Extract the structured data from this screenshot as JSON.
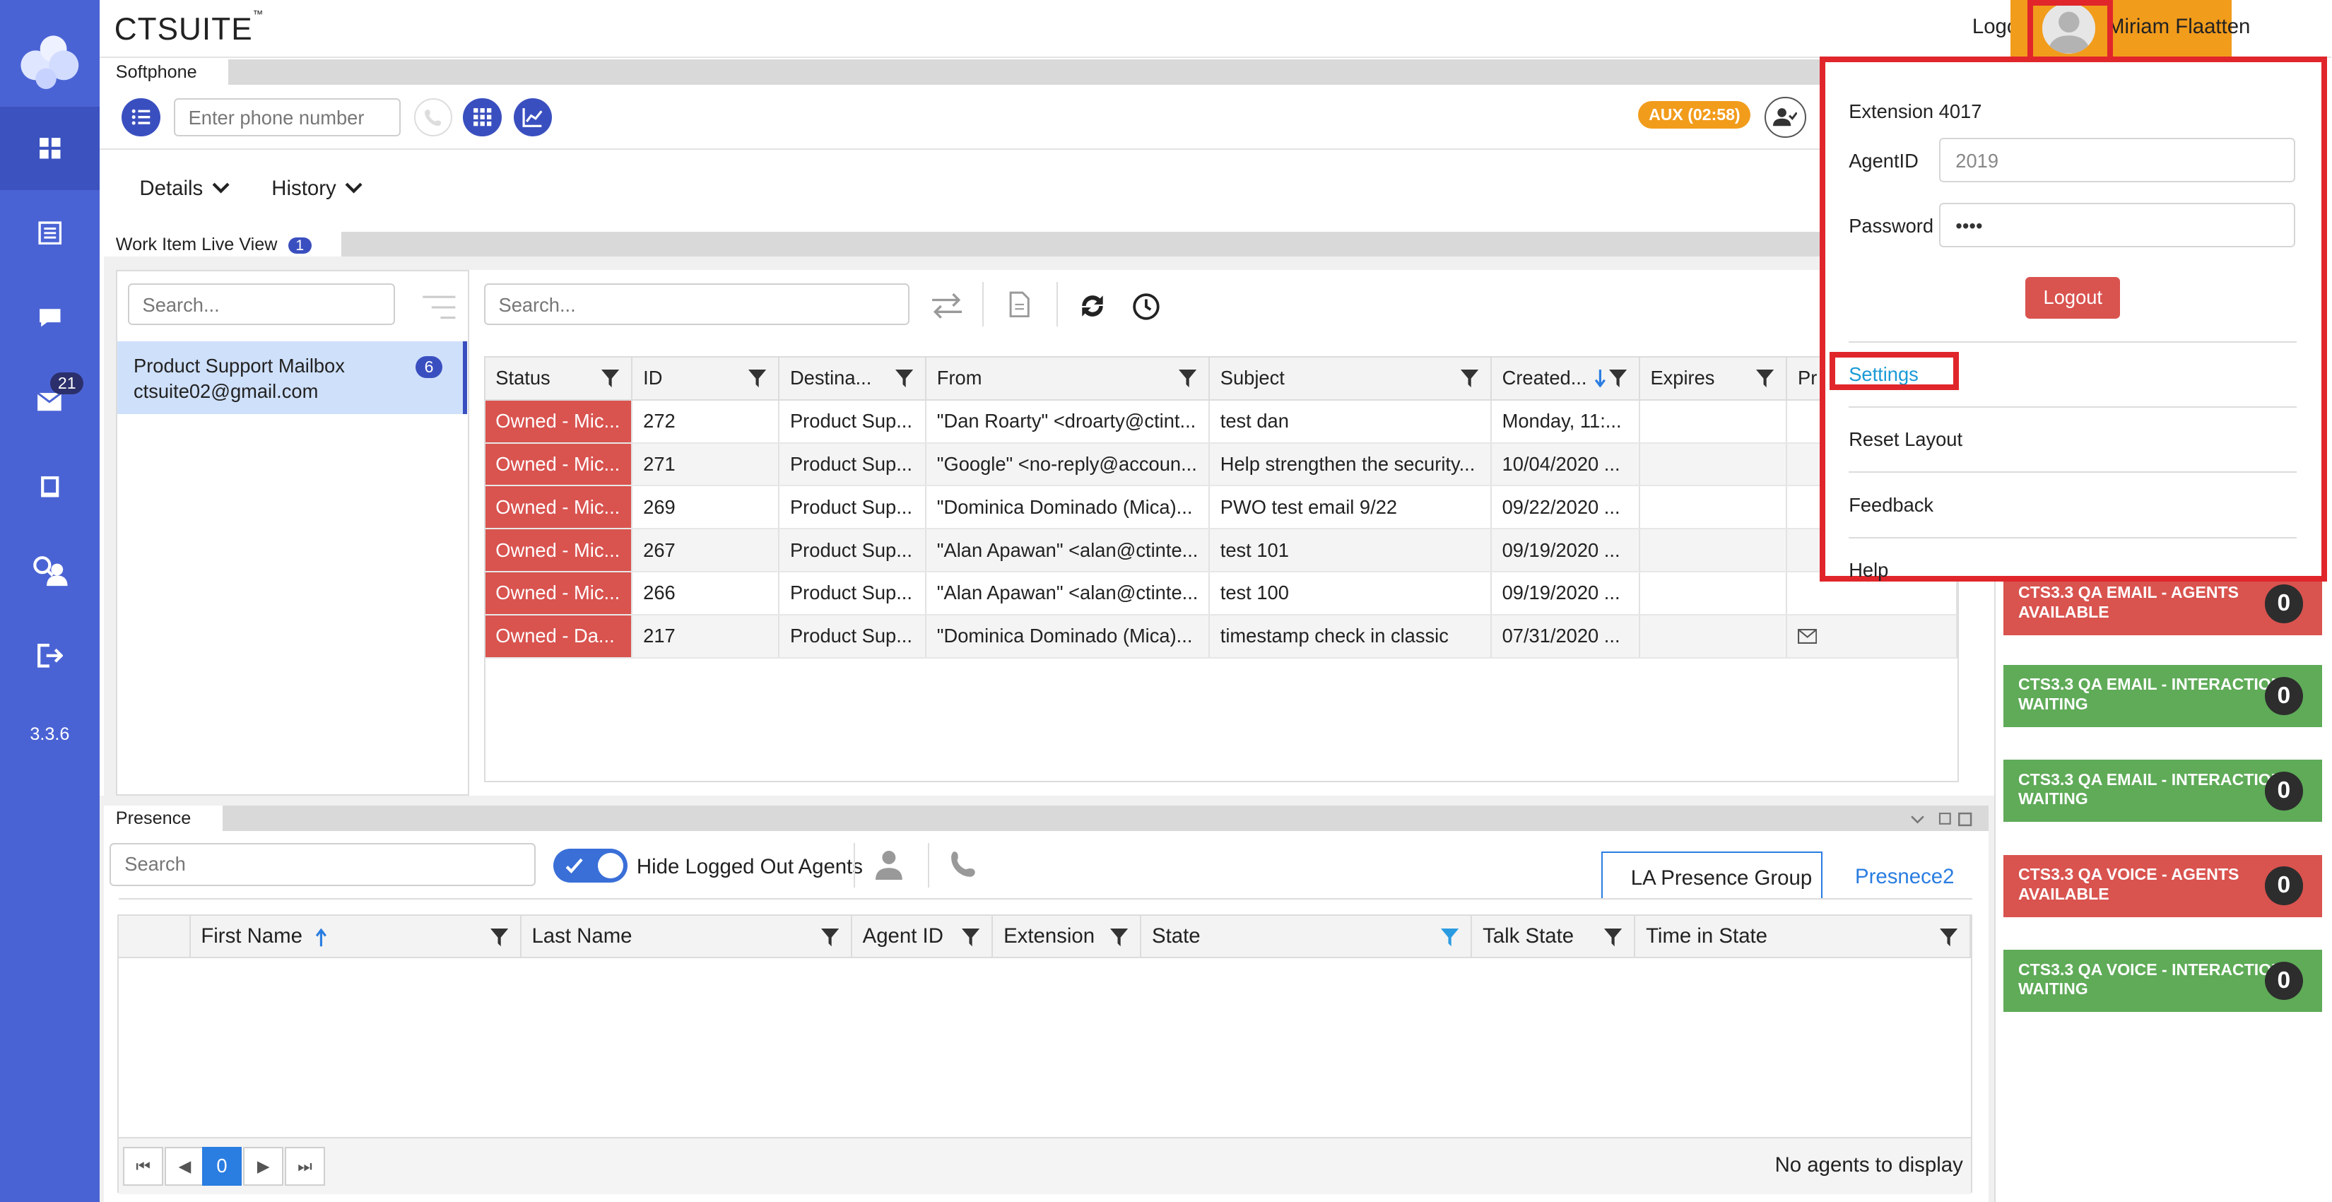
{
  "sidebar": {
    "items": [
      {
        "icon": "dashboard-icon"
      },
      {
        "icon": "list-icon"
      },
      {
        "icon": "chat-icon"
      },
      {
        "icon": "email-icon",
        "badge": "21"
      },
      {
        "icon": "book-icon"
      },
      {
        "icon": "users-search-icon"
      },
      {
        "icon": "sign-out-icon"
      }
    ],
    "version": "3.3.6"
  },
  "header": {
    "brand": "CTSUITE",
    "logout_label": "Logout",
    "user_name": "Miriam Flaatten"
  },
  "softphone": {
    "tab_label": "Softphone",
    "phone_placeholder": "Enter phone number",
    "aux_status": "AUX (02:58)",
    "details_label": "Details",
    "history_label": "History"
  },
  "work_item": {
    "tab_label": "Work Item Live View",
    "tab_badge": "1",
    "left_search_placeholder": "Search...",
    "right_search_placeholder": "Search...",
    "mailbox": {
      "name": "Product Support Mailbox",
      "email": "ctsuite02@gmail.com",
      "count": "6"
    },
    "columns": [
      "Status",
      "ID",
      "Destina...",
      "From",
      "Subject",
      "Created...",
      "Expires",
      "Pr"
    ],
    "rows": [
      {
        "status": "Owned - Mic...",
        "id": "272",
        "dest": "Product Sup...",
        "from": "\"Dan Roarty\" <droarty@ctint...",
        "subject": "test dan",
        "created": "Monday, 11:...",
        "expires": ""
      },
      {
        "status": "Owned - Mic...",
        "id": "271",
        "dest": "Product Sup...",
        "from": "\"Google\" <no-reply@accoun...",
        "subject": "Help strengthen the security...",
        "created": "10/04/2020 ...",
        "expires": ""
      },
      {
        "status": "Owned - Mic...",
        "id": "269",
        "dest": "Product Sup...",
        "from": "\"Dominica Dominado (Mica)...",
        "subject": "PWO test email 9/22",
        "created": "09/22/2020 ...",
        "expires": ""
      },
      {
        "status": "Owned - Mic...",
        "id": "267",
        "dest": "Product Sup...",
        "from": "\"Alan Apawan\" <alan@ctinte...",
        "subject": "test 101",
        "created": "09/19/2020 ...",
        "expires": ""
      },
      {
        "status": "Owned - Mic...",
        "id": "266",
        "dest": "Product Sup...",
        "from": "\"Alan Apawan\" <alan@ctinte...",
        "subject": "test 100",
        "created": "09/19/2020 ...",
        "expires": ""
      },
      {
        "status": "Owned - Da...",
        "id": "217",
        "dest": "Product Sup...",
        "from": "\"Dominica Dominado (Mica)...",
        "subject": "timestamp check in classic",
        "created": "07/31/2020 ...",
        "expires": ""
      }
    ]
  },
  "user_menu": {
    "extension_label": "Extension 4017",
    "agentid_label": "AgentID",
    "agentid_value": "2019",
    "password_label": "Password",
    "password_value": "••••",
    "logout_button": "Logout",
    "items": [
      "Settings",
      "Reset Layout",
      "Feedback",
      "Help"
    ]
  },
  "queues": [
    {
      "label": "CTS3.3 QA EMAIL - AGENTS AVAILABLE",
      "count": "0",
      "color": "#d9534f"
    },
    {
      "label": "CTS3.3 QA EMAIL - INTERACTIONS WAITING",
      "count": "0",
      "color": "#5fab58"
    },
    {
      "label": "CTS3.3 QA EMAIL - INTERACTIONS WAITING",
      "count": "0",
      "color": "#5fab58"
    },
    {
      "label": "CTS3.3 QA VOICE - AGENTS AVAILABLE",
      "count": "0",
      "color": "#d9534f"
    },
    {
      "label": "CTS3.3 QA VOICE - INTERACTIONS WAITING",
      "count": "0",
      "color": "#5fab58"
    }
  ],
  "presence": {
    "tab_label": "Presence",
    "search_placeholder": "Search",
    "hide_logged_out_label": "Hide Logged Out Agents",
    "hide_logged_out_on": true,
    "group_tabs": [
      "LA Presence Group",
      "Presnece2"
    ],
    "columns": [
      "First Name",
      "Last Name",
      "Agent ID",
      "Extension",
      "State",
      "Talk State",
      "Time in State"
    ],
    "page": "0",
    "empty_message": "No agents to display"
  }
}
